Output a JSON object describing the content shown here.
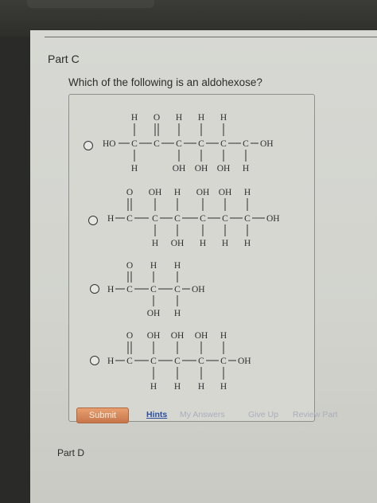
{
  "browser": {
    "tab_text": ""
  },
  "part_c": {
    "heading": "Part C",
    "question": "Which of the following is an aldohexose?",
    "options": [
      {
        "id": "option-1",
        "top_row": [
          "H",
          "O",
          "H",
          "H",
          "H"
        ],
        "main_chain": [
          "HO",
          "C",
          "C",
          "C",
          "C",
          "C",
          "C",
          "OH"
        ],
        "bottom_row": [
          "H",
          "OH",
          "OH",
          "OH",
          "H"
        ]
      },
      {
        "id": "option-2",
        "top_row": [
          "O",
          "OH",
          "H",
          "OH",
          "OH",
          "H"
        ],
        "main_chain": [
          "H",
          "C",
          "C",
          "C",
          "C",
          "C",
          "C",
          "OH"
        ],
        "bottom_row": [
          "H",
          "OH",
          "H",
          "H",
          "H"
        ]
      },
      {
        "id": "option-3",
        "top_row": [
          "O",
          "H",
          "H"
        ],
        "main_chain": [
          "H",
          "C",
          "C",
          "C",
          "OH"
        ],
        "bottom_row": [
          "OH",
          "H"
        ]
      },
      {
        "id": "option-4",
        "top_row": [
          "O",
          "OH",
          "OH",
          "OH",
          "H"
        ],
        "main_chain": [
          "H",
          "C",
          "C",
          "C",
          "C",
          "C",
          "OH"
        ],
        "bottom_row": [
          "H",
          "H",
          "H",
          "H"
        ]
      }
    ]
  },
  "actions": {
    "submit": "Submit",
    "hints": "Hints",
    "my_answers": "My Answers",
    "give_up": "Give Up",
    "review_part": "Review Part"
  },
  "part_d": {
    "heading": "Part D"
  },
  "colors": {
    "submit_bg": "#d4845a",
    "hints_link": "#2a4fa0",
    "disabled_link": "#a9aebb"
  }
}
